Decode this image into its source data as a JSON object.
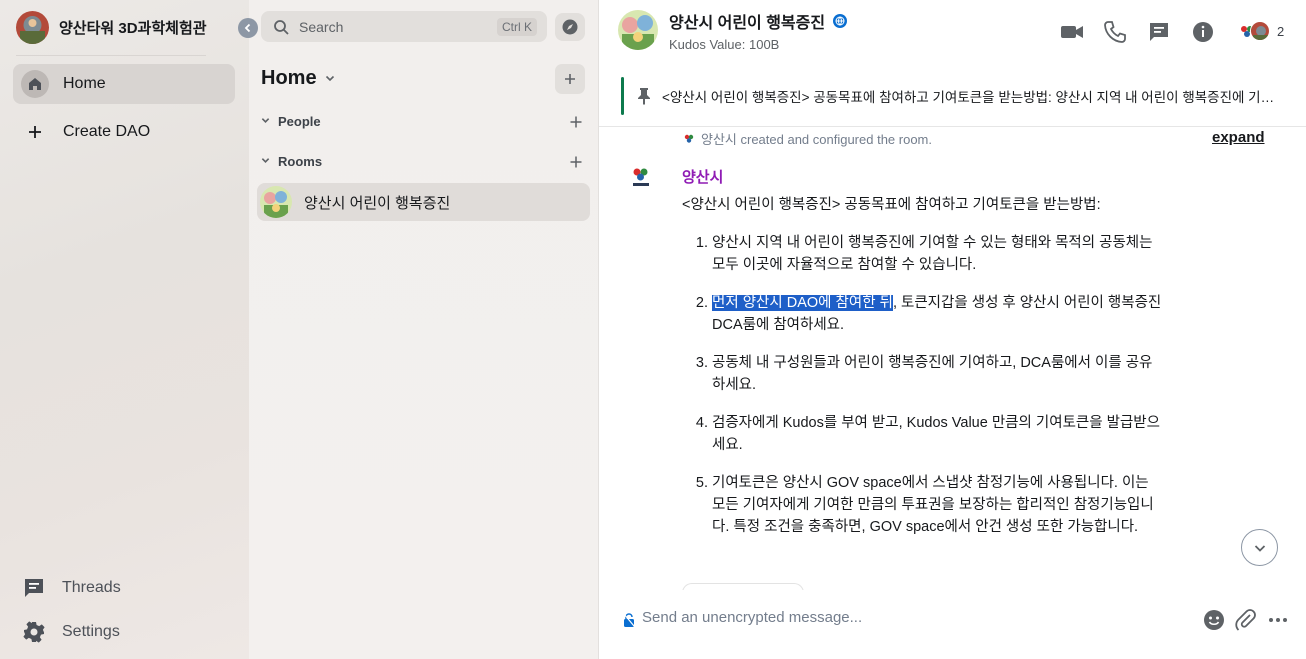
{
  "space": {
    "title": "양산타워 3D과학체험관",
    "nav": [
      {
        "label": "Home",
        "active": true
      },
      {
        "label": "Create DAO",
        "active": false
      }
    ],
    "footer": [
      {
        "label": "Threads"
      },
      {
        "label": "Settings"
      }
    ]
  },
  "roomlist": {
    "search_placeholder": "Search",
    "shortcut": "Ctrl K",
    "header": "Home",
    "sections": [
      {
        "label": "People"
      },
      {
        "label": "Rooms"
      }
    ],
    "rooms": [
      {
        "name": "양산시 어린이 행복증진",
        "selected": true
      }
    ]
  },
  "room": {
    "name": "양산시 어린이 행복증진",
    "topic": "Kudos Value: 100B",
    "member_count": "2",
    "pinned": "<양산시 어린이 행복증진> 공동목표에 참여하고 기여토큰을 받는방법: 양산시 지역 내 어린이 행복증진에 기여할 수 있는 형태와 목적의 공동체는 모두 이곳에 자율적으로 참여할 수 있습니다.",
    "created_event": "양산시 created and configured the room.",
    "expand_label": "expand",
    "sender": "양산시",
    "intro": "<양산시 어린이 행복증진> 공동목표에 참여하고 기여토큰을 받는방법:",
    "steps": [
      {
        "text": "양산시 지역 내 어린이 행복증진에 기여할 수 있는 형태와 목적의 공동체는 모두 이곳에 자율적으로 참여할 수 있습니다."
      },
      {
        "highlight": "먼저 양산시 DAO에 참여한 뒤",
        "text": ", 토큰지갑을 생성 후 양산시 어린이 행복증진 DCA룸에 참여하세요."
      },
      {
        "text": "공동체 내 구성원들과 어린이 행복증진에 기여하고, DCA룸에서 이를 공유하세요."
      },
      {
        "text": "검증자에게 Kudos를 부여 받고, Kudos Value 만큼의 기여토큰을 발급받으세요."
      },
      {
        "text": "기여토큰은 양산시 GOV space에서 스냅샷 참정기능에 사용됩니다. 이는 모든 기여자에게 기여한 만큼의 투표권을 보장하는 합리적인 참정기능입니다. 특정 조건을 충족하면, GOV space에서 안건 생성 또한 가능합니다."
      }
    ],
    "composer_placeholder": "Send an unencrypted message..."
  },
  "icons": {
    "home": "home-icon",
    "plus": "plus-icon",
    "threads": "threads-icon",
    "settings": "gear-icon",
    "search": "search-icon",
    "explore": "compass-icon",
    "video": "video-call-icon",
    "voice": "phone-icon",
    "thread": "thread-icon",
    "info": "info-icon",
    "pin": "pin-icon",
    "emoji": "emoji-icon",
    "attach": "paperclip-icon",
    "more": "more-icon"
  },
  "colors": {
    "accent": "#0d7a4d",
    "sender": "#8f1bb4",
    "highlight": "#1e5fc8"
  }
}
